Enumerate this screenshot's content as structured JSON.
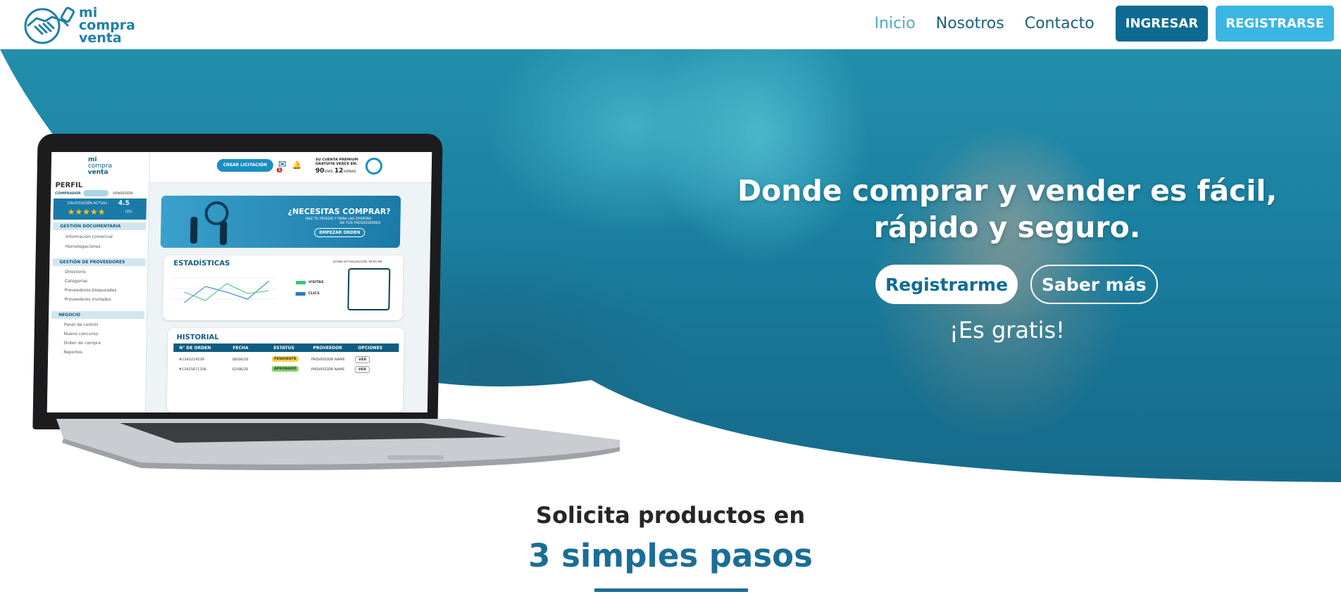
{
  "brand": {
    "logo_line1": "mi",
    "logo_line2": "compra",
    "logo_line3": "venta",
    "primary_color": "#0e6a91",
    "accent_color": "#3bb5e2"
  },
  "nav": {
    "items": [
      {
        "label": "Inicio",
        "active": true
      },
      {
        "label": "Nosotros",
        "active": false
      },
      {
        "label": "Contacto",
        "active": false
      }
    ],
    "login_label": "INGRESAR",
    "register_label": "REGISTRARSE"
  },
  "hero": {
    "headline": "Donde comprar y vender es fácil, rápido y seguro.",
    "primary_cta": "Registrarme",
    "secondary_cta": "Saber más",
    "note": "¡Es gratis!"
  },
  "laptop_screen": {
    "logo_line1": "mi",
    "logo_line2": "compra",
    "logo_line3": "venta",
    "create_button": "CREAR LICITACIÓN",
    "premium_line1": "SU CUENTA PREMIUM",
    "premium_line2": "GRATUITA VENCE EN:",
    "premium_days": "90",
    "premium_days_label": "DÍAS",
    "premium_hours": "12",
    "premium_hours_label": "HORAS",
    "notifications": "1",
    "profile_label": "PERFIL",
    "toggle_left": "COMPRADOR",
    "toggle_right": "VENDEDOR",
    "rating_label": "CALIFICACIÓN ACTUAL:",
    "rating_value": "4.5",
    "rating_count": "(35)",
    "sections": [
      {
        "title": "GESTIÓN DOCUMENTARIA",
        "items": [
          "Información comercial",
          "Homologaciones"
        ]
      },
      {
        "title": "GESTIÓN DE PROVEEDORES",
        "items": [
          "Directorio",
          "Categorías",
          "Proveedores bloqueados",
          "Proveedores invitados"
        ]
      },
      {
        "title": "NEGOCIO",
        "items": [
          "Panel de control",
          "Nuevo concurso",
          "Orden de compra",
          "Reportes"
        ]
      }
    ],
    "banner_title": "¿NECESITAS COMPRAR?",
    "banner_sub1": "HAZ TU PEDIDO Y MIRA LAS OFERTAS",
    "banner_sub2": "DE TUS PROVEEDORES",
    "banner_button": "EMPEZAR ORDEN",
    "stats_title": "ESTADÍSTICAS",
    "stats_update": "ÚLTIMA ACTUALIZACIÓN: 08:00 AM",
    "legend_visits": "VISITAS",
    "legend_clicks": "CLICS",
    "history_title": "HISTORIAL",
    "history_columns": [
      "N° DE ORDEN",
      "FECHA",
      "ESTATUS",
      "PROVEEDOR",
      "OPCIONES"
    ],
    "history_rows": [
      [
        "#1345214539",
        "06/06/20",
        "PENDIENTE",
        "PROVEEDOR NAME",
        "VER"
      ],
      [
        "#13425671336",
        "02/06/20",
        "APROBADO",
        "PROVEEDOR NAME",
        "VER"
      ]
    ]
  },
  "steps": {
    "title": "Solicita productos en",
    "subtitle": "3 simples pasos"
  }
}
